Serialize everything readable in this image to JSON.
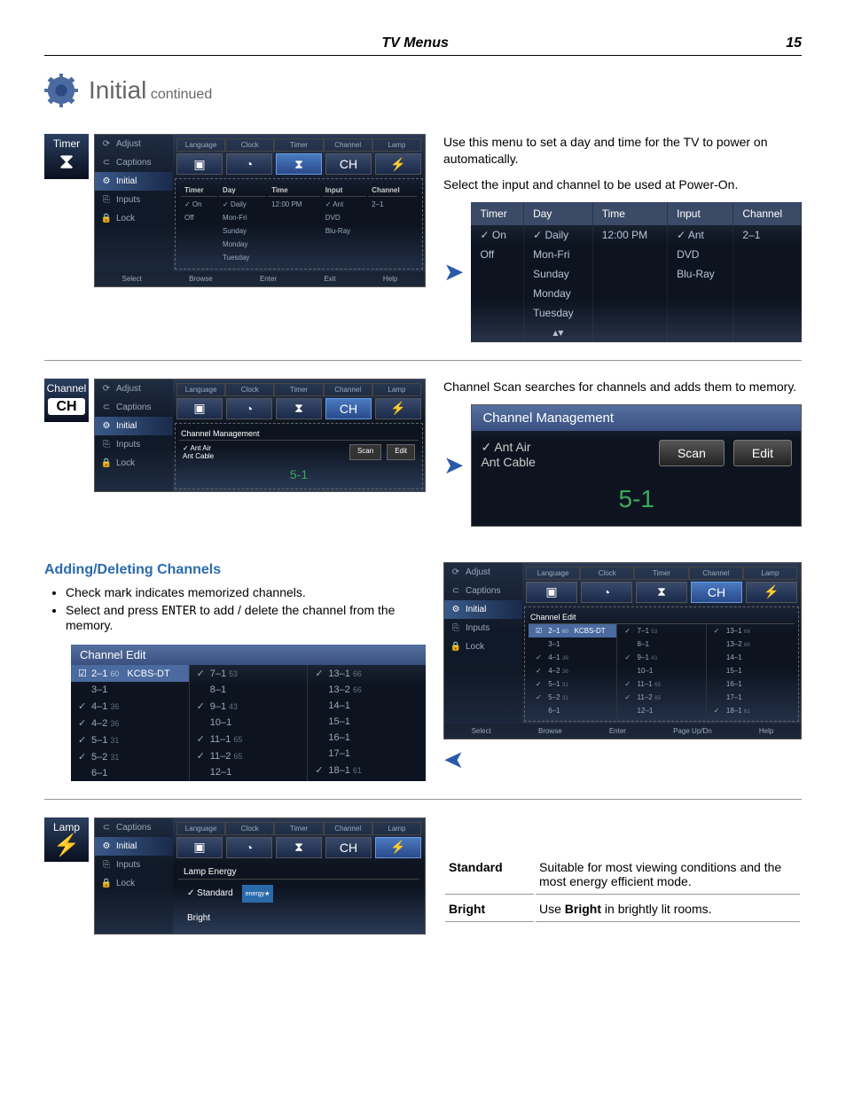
{
  "header": {
    "section": "TV Menus",
    "page": "15"
  },
  "title": {
    "main": "Initial",
    "sub": "continued"
  },
  "timer": {
    "label": "Timer",
    "intro1": "Use this menu to set a day and time for the TV to power on automatically.",
    "intro2": "Select the input and channel to be used at Power-On.",
    "sidebar": [
      "Adjust",
      "Captions",
      "Initial",
      "Inputs",
      "Lock"
    ],
    "tabs": [
      "Language",
      "Clock",
      "Timer",
      "Channel",
      "Lamp"
    ],
    "cols": [
      "Timer",
      "Day",
      "Time",
      "Input",
      "Channel"
    ],
    "rows": [
      [
        "✓ On",
        "✓ Daily",
        "12:00 PM",
        "✓ Ant",
        "2–1"
      ],
      [
        "Off",
        "Mon-Fri",
        "",
        "DVD",
        ""
      ],
      [
        "",
        "Sunday",
        "",
        "Blu-Ray",
        ""
      ],
      [
        "",
        "Monday",
        "",
        "",
        ""
      ],
      [
        "",
        "Tuesday",
        "",
        "",
        ""
      ]
    ],
    "footer": [
      "Select",
      "Browse",
      "Enter",
      "Exit",
      "Help"
    ]
  },
  "channel": {
    "label": "Channel",
    "intro": "Channel Scan searches for channels and adds them to memory.",
    "cm_title": "Channel Management",
    "opts": [
      "✓ Ant Air",
      "Ant Cable"
    ],
    "scan": "Scan",
    "edit": "Edit",
    "current": "5-1",
    "osd_current": "5-1"
  },
  "adding": {
    "heading": "Adding/Deleting Channels",
    "b1": "Check mark indicates memorized channels.",
    "b2a": "Select and press ",
    "b2b": "ENTER",
    "b2c": " to add / delete the channel from the memory.",
    "ce_title": "Channel Edit",
    "cols": [
      [
        {
          "c": "2–1",
          "s": "60",
          "chk": "☑",
          "name": "KCBS-DT"
        },
        {
          "c": "3–1"
        },
        {
          "c": "4–1",
          "s": "36",
          "chk": "✓"
        },
        {
          "c": "4–2",
          "s": "36",
          "chk": "✓"
        },
        {
          "c": "5–1",
          "s": "31",
          "chk": "✓"
        },
        {
          "c": "5–2",
          "s": "31",
          "chk": "✓"
        },
        {
          "c": "6–1"
        }
      ],
      [
        {
          "c": "7–1",
          "s": "53",
          "chk": "✓"
        },
        {
          "c": "8–1"
        },
        {
          "c": "9–1",
          "s": "43",
          "chk": "✓"
        },
        {
          "c": "10–1"
        },
        {
          "c": "11–1",
          "s": "65",
          "chk": "✓"
        },
        {
          "c": "11–2",
          "s": "65",
          "chk": "✓"
        },
        {
          "c": "12–1"
        }
      ],
      [
        {
          "c": "13–1",
          "s": "66",
          "chk": "✓"
        },
        {
          "c": "13–2",
          "s": "66"
        },
        {
          "c": "14–1"
        },
        {
          "c": "15–1"
        },
        {
          "c": "16–1"
        },
        {
          "c": "17–1"
        },
        {
          "c": "18–1",
          "s": "61",
          "chk": "✓"
        }
      ]
    ],
    "osd_footer": [
      "Select",
      "Browse",
      "Enter",
      "Page Up/Dn",
      "Help"
    ]
  },
  "lamp": {
    "label": "Lamp",
    "tabs": [
      "Language",
      "Clock",
      "Timer",
      "Channel",
      "Lamp"
    ],
    "section_title": "Lamp Energy",
    "opts": [
      "✓ Standard",
      "Bright"
    ],
    "t1l": "Standard",
    "t1v": "Suitable for most viewing conditions and the most energy efficient mode.",
    "t2l": "Bright",
    "t2va": "Use ",
    "t2vb": "Bright",
    "t2vc": " in brightly lit rooms."
  }
}
